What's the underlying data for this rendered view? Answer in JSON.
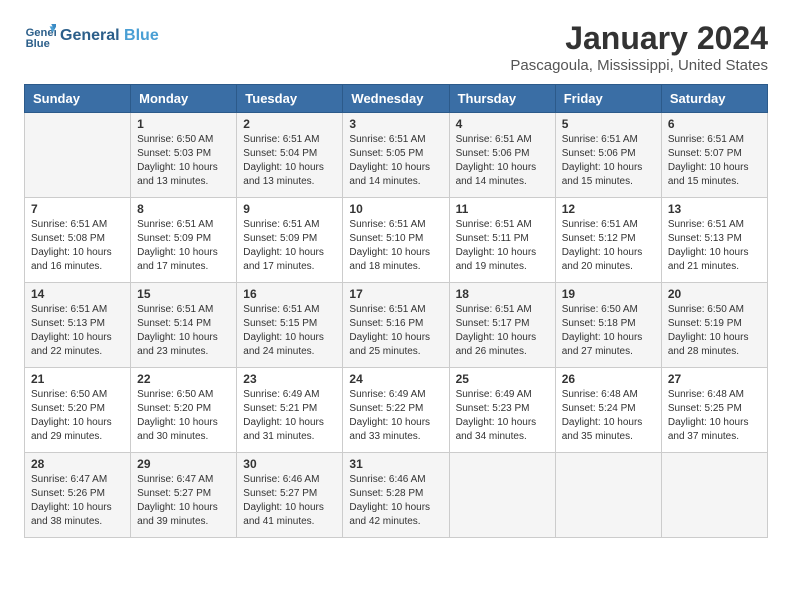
{
  "header": {
    "logo_line1": "General",
    "logo_line2": "Blue",
    "title": "January 2024",
    "subtitle": "Pascagoula, Mississippi, United States"
  },
  "calendar": {
    "days_of_week": [
      "Sunday",
      "Monday",
      "Tuesday",
      "Wednesday",
      "Thursday",
      "Friday",
      "Saturday"
    ],
    "weeks": [
      [
        {
          "day": "",
          "sunrise": "",
          "sunset": "",
          "daylight": ""
        },
        {
          "day": "1",
          "sunrise": "Sunrise: 6:50 AM",
          "sunset": "Sunset: 5:03 PM",
          "daylight": "Daylight: 10 hours and 13 minutes."
        },
        {
          "day": "2",
          "sunrise": "Sunrise: 6:51 AM",
          "sunset": "Sunset: 5:04 PM",
          "daylight": "Daylight: 10 hours and 13 minutes."
        },
        {
          "day": "3",
          "sunrise": "Sunrise: 6:51 AM",
          "sunset": "Sunset: 5:05 PM",
          "daylight": "Daylight: 10 hours and 14 minutes."
        },
        {
          "day": "4",
          "sunrise": "Sunrise: 6:51 AM",
          "sunset": "Sunset: 5:06 PM",
          "daylight": "Daylight: 10 hours and 14 minutes."
        },
        {
          "day": "5",
          "sunrise": "Sunrise: 6:51 AM",
          "sunset": "Sunset: 5:06 PM",
          "daylight": "Daylight: 10 hours and 15 minutes."
        },
        {
          "day": "6",
          "sunrise": "Sunrise: 6:51 AM",
          "sunset": "Sunset: 5:07 PM",
          "daylight": "Daylight: 10 hours and 15 minutes."
        }
      ],
      [
        {
          "day": "7",
          "sunrise": "Sunrise: 6:51 AM",
          "sunset": "Sunset: 5:08 PM",
          "daylight": "Daylight: 10 hours and 16 minutes."
        },
        {
          "day": "8",
          "sunrise": "Sunrise: 6:51 AM",
          "sunset": "Sunset: 5:09 PM",
          "daylight": "Daylight: 10 hours and 17 minutes."
        },
        {
          "day": "9",
          "sunrise": "Sunrise: 6:51 AM",
          "sunset": "Sunset: 5:09 PM",
          "daylight": "Daylight: 10 hours and 17 minutes."
        },
        {
          "day": "10",
          "sunrise": "Sunrise: 6:51 AM",
          "sunset": "Sunset: 5:10 PM",
          "daylight": "Daylight: 10 hours and 18 minutes."
        },
        {
          "day": "11",
          "sunrise": "Sunrise: 6:51 AM",
          "sunset": "Sunset: 5:11 PM",
          "daylight": "Daylight: 10 hours and 19 minutes."
        },
        {
          "day": "12",
          "sunrise": "Sunrise: 6:51 AM",
          "sunset": "Sunset: 5:12 PM",
          "daylight": "Daylight: 10 hours and 20 minutes."
        },
        {
          "day": "13",
          "sunrise": "Sunrise: 6:51 AM",
          "sunset": "Sunset: 5:13 PM",
          "daylight": "Daylight: 10 hours and 21 minutes."
        }
      ],
      [
        {
          "day": "14",
          "sunrise": "Sunrise: 6:51 AM",
          "sunset": "Sunset: 5:13 PM",
          "daylight": "Daylight: 10 hours and 22 minutes."
        },
        {
          "day": "15",
          "sunrise": "Sunrise: 6:51 AM",
          "sunset": "Sunset: 5:14 PM",
          "daylight": "Daylight: 10 hours and 23 minutes."
        },
        {
          "day": "16",
          "sunrise": "Sunrise: 6:51 AM",
          "sunset": "Sunset: 5:15 PM",
          "daylight": "Daylight: 10 hours and 24 minutes."
        },
        {
          "day": "17",
          "sunrise": "Sunrise: 6:51 AM",
          "sunset": "Sunset: 5:16 PM",
          "daylight": "Daylight: 10 hours and 25 minutes."
        },
        {
          "day": "18",
          "sunrise": "Sunrise: 6:51 AM",
          "sunset": "Sunset: 5:17 PM",
          "daylight": "Daylight: 10 hours and 26 minutes."
        },
        {
          "day": "19",
          "sunrise": "Sunrise: 6:50 AM",
          "sunset": "Sunset: 5:18 PM",
          "daylight": "Daylight: 10 hours and 27 minutes."
        },
        {
          "day": "20",
          "sunrise": "Sunrise: 6:50 AM",
          "sunset": "Sunset: 5:19 PM",
          "daylight": "Daylight: 10 hours and 28 minutes."
        }
      ],
      [
        {
          "day": "21",
          "sunrise": "Sunrise: 6:50 AM",
          "sunset": "Sunset: 5:20 PM",
          "daylight": "Daylight: 10 hours and 29 minutes."
        },
        {
          "day": "22",
          "sunrise": "Sunrise: 6:50 AM",
          "sunset": "Sunset: 5:20 PM",
          "daylight": "Daylight: 10 hours and 30 minutes."
        },
        {
          "day": "23",
          "sunrise": "Sunrise: 6:49 AM",
          "sunset": "Sunset: 5:21 PM",
          "daylight": "Daylight: 10 hours and 31 minutes."
        },
        {
          "day": "24",
          "sunrise": "Sunrise: 6:49 AM",
          "sunset": "Sunset: 5:22 PM",
          "daylight": "Daylight: 10 hours and 33 minutes."
        },
        {
          "day": "25",
          "sunrise": "Sunrise: 6:49 AM",
          "sunset": "Sunset: 5:23 PM",
          "daylight": "Daylight: 10 hours and 34 minutes."
        },
        {
          "day": "26",
          "sunrise": "Sunrise: 6:48 AM",
          "sunset": "Sunset: 5:24 PM",
          "daylight": "Daylight: 10 hours and 35 minutes."
        },
        {
          "day": "27",
          "sunrise": "Sunrise: 6:48 AM",
          "sunset": "Sunset: 5:25 PM",
          "daylight": "Daylight: 10 hours and 37 minutes."
        }
      ],
      [
        {
          "day": "28",
          "sunrise": "Sunrise: 6:47 AM",
          "sunset": "Sunset: 5:26 PM",
          "daylight": "Daylight: 10 hours and 38 minutes."
        },
        {
          "day": "29",
          "sunrise": "Sunrise: 6:47 AM",
          "sunset": "Sunset: 5:27 PM",
          "daylight": "Daylight: 10 hours and 39 minutes."
        },
        {
          "day": "30",
          "sunrise": "Sunrise: 6:46 AM",
          "sunset": "Sunset: 5:27 PM",
          "daylight": "Daylight: 10 hours and 41 minutes."
        },
        {
          "day": "31",
          "sunrise": "Sunrise: 6:46 AM",
          "sunset": "Sunset: 5:28 PM",
          "daylight": "Daylight: 10 hours and 42 minutes."
        },
        {
          "day": "",
          "sunrise": "",
          "sunset": "",
          "daylight": ""
        },
        {
          "day": "",
          "sunrise": "",
          "sunset": "",
          "daylight": ""
        },
        {
          "day": "",
          "sunrise": "",
          "sunset": "",
          "daylight": ""
        }
      ]
    ]
  }
}
